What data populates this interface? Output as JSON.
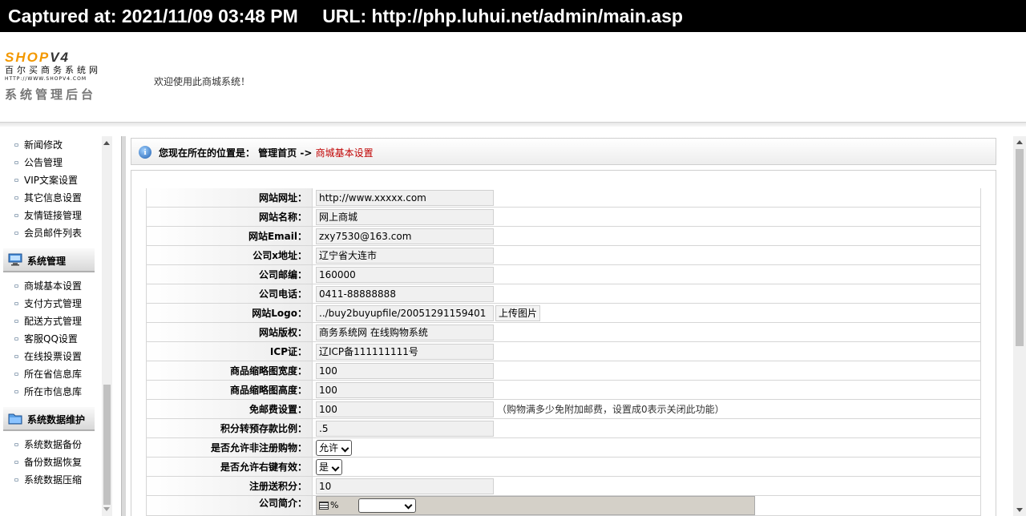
{
  "capture": {
    "captured": "Captured at: 2021/11/09 03:48 PM",
    "url": "URL: http://php.luhui.net/admin/main.asp"
  },
  "header": {
    "logo_main": "SHOP",
    "logo_version": "V4",
    "logo_sub": "百尔买商务系统网",
    "logo_url": "HTTP://WWW.SHOPV4.COM",
    "logo_admin": "系统管理后台",
    "welcome": "欢迎使用此商城系统！"
  },
  "sidebar": {
    "top_items": [
      "新闻修改",
      "公告管理",
      "VIP文案设置",
      "其它信息设置",
      "友情链接管理",
      "会员邮件列表"
    ],
    "group_system": "系统管理",
    "system_items": [
      "商城基本设置",
      "支付方式管理",
      "配送方式管理",
      "客服QQ设置",
      "在线投票设置",
      "所在省信息库",
      "所在市信息库"
    ],
    "group_data": "系统数据维护",
    "data_items": [
      "系统数据备份",
      "备份数据恢复",
      "系统数据压缩"
    ]
  },
  "breadcrumb": {
    "prefix": "您现在所在的位置是： 管理首页 ->",
    "current": "商城基本设置"
  },
  "form": {
    "site_url": {
      "label": "网站网址：",
      "value": "http://www.xxxxx.com"
    },
    "site_name": {
      "label": "网站名称：",
      "value": "网上商城"
    },
    "site_email": {
      "label": "网站Email：",
      "value": "zxy7530@163.com"
    },
    "company_addr": {
      "label": "公司x地址：",
      "value": "辽宁省大连市"
    },
    "company_zip": {
      "label": "公司邮编：",
      "value": "160000"
    },
    "company_phone": {
      "label": "公司电话：",
      "value": "0411-88888888"
    },
    "site_logo": {
      "label": "网站Logo：",
      "value": "../buy2buyupfile/20051291159401",
      "button": "上传图片"
    },
    "site_copyright": {
      "label": "网站版权：",
      "value": "商务系统网 在线购物系统"
    },
    "icp": {
      "label": "ICP证：",
      "value": "辽ICP备111111111号"
    },
    "thumb_width": {
      "label": "商品缩略图宽度：",
      "value": "100"
    },
    "thumb_height": {
      "label": "商品缩略图高度：",
      "value": "100"
    },
    "free_shipping": {
      "label": "免邮费设置：",
      "value": "100",
      "note": "（购物满多少免附加邮费，设置成0表示关闭此功能）"
    },
    "points_ratio": {
      "label": "积分转预存款比例：",
      "value": ".5"
    },
    "guest_purchase": {
      "label": "是否允许非注册购物：",
      "value": "允许"
    },
    "right_click": {
      "label": "是否允许右键有效：",
      "value": "是"
    },
    "register_points": {
      "label": "注册送积分：",
      "value": "10"
    },
    "company_intro": {
      "label": "公司简介：",
      "editor_text": "%"
    }
  }
}
